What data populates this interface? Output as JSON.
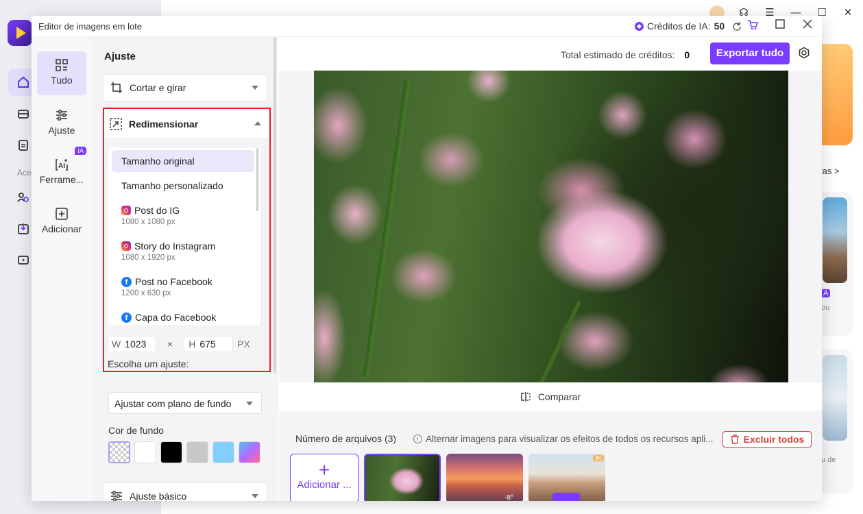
{
  "background_app": {
    "nav_label": "Ace",
    "card_text_1": "tas >",
    "card_text_2": "A",
    "card_text_3": "ou",
    "card_text_4": "u de"
  },
  "dialog": {
    "title": "Editor de imagens em lote",
    "credits_label": "Créditos de IA:",
    "credits_value": "50"
  },
  "vnav": {
    "items": [
      {
        "label": "Tudo",
        "icon": "grid-icon",
        "active": true
      },
      {
        "label": "Ajuste",
        "icon": "sliders-icon"
      },
      {
        "label": "Ferrame...",
        "icon": "ai-tools-icon",
        "badge": "IA"
      },
      {
        "label": "Adicionar",
        "icon": "add-icon"
      }
    ]
  },
  "panel": {
    "title": "Ajuste",
    "crop_label": "Cortar e girar",
    "resize_label": "Redimensionar",
    "sizes": [
      {
        "label": "Tamanho original",
        "selected": true
      },
      {
        "label": "Tamanho personalizado"
      },
      {
        "label": "Post do IG",
        "sub": "1080 x 1080 px",
        "icon": "instagram-icon"
      },
      {
        "label": "Story do Instagram",
        "sub": "1080 x 1920 px",
        "icon": "instagram-icon"
      },
      {
        "label": "Post no Facebook",
        "sub": "1200 x 630 px",
        "icon": "facebook-icon"
      },
      {
        "label": "Capa do Facebook",
        "icon": "facebook-icon"
      }
    ],
    "width_label": "W",
    "width_value": "1023",
    "times": "×",
    "height_label": "H",
    "height_value": "675",
    "unit": "PX",
    "choose_label": "Escolha um ajuste:",
    "fit_option": "Ajustar com plano de fundo",
    "bgcolor_label": "Cor de fundo",
    "swatch_colors": [
      "transparent",
      "#ffffff",
      "#000000",
      "#c8c8c8",
      "#82cfff",
      "gradient"
    ],
    "basic_adjust_label": "Ajuste básico"
  },
  "main": {
    "total_label": "Total estimado de créditos:",
    "total_value": "0",
    "export_label": "Exportar tudo",
    "compare_label": "Comparar",
    "files_label": "Número de arquivos (3)",
    "hint": "Alternar imagens para visualizar os efeitos de todos os recursos apli...",
    "delete_all_label": "Excluir todos",
    "add_label": "Adicionar ...",
    "thumb2_badge": "-8°",
    "thumb3_badge": "8K",
    "accent_color": "#7a3cff"
  }
}
